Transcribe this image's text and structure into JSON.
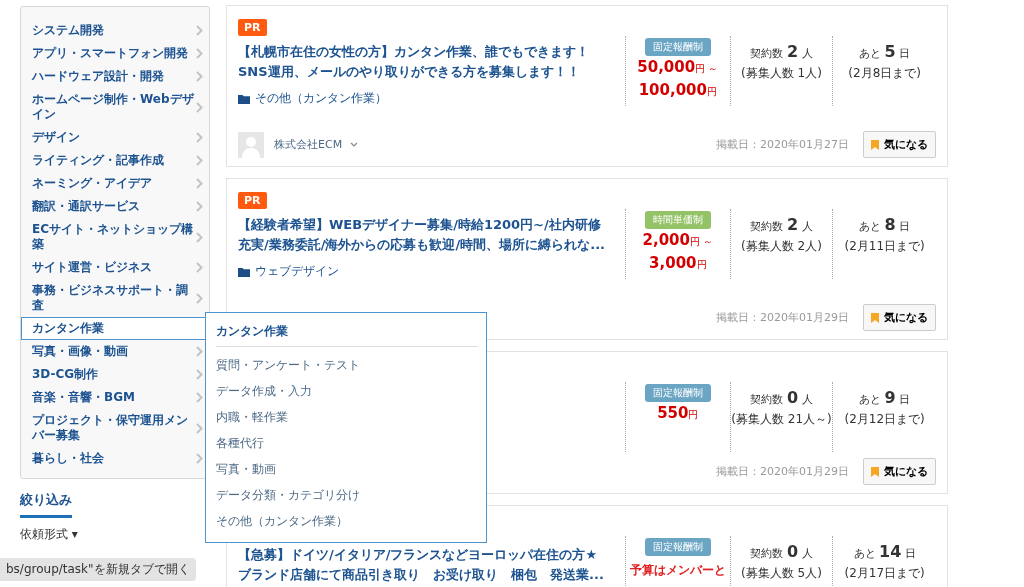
{
  "sidebar": {
    "items": [
      {
        "label": "システム開発",
        "selected": false
      },
      {
        "label": "アプリ・スマートフォン開発",
        "selected": false
      },
      {
        "label": "ハードウェア設計・開発",
        "selected": false
      },
      {
        "label": "ホームページ制作・Webデザイン",
        "selected": false
      },
      {
        "label": "デザイン",
        "selected": false
      },
      {
        "label": "ライティング・記事作成",
        "selected": false
      },
      {
        "label": "ネーミング・アイデア",
        "selected": false
      },
      {
        "label": "翻訳・通訳サービス",
        "selected": false
      },
      {
        "label": "ECサイト・ネットショップ構築",
        "selected": false
      },
      {
        "label": "サイト運営・ビジネス",
        "selected": false
      },
      {
        "label": "事務・ビジネスサポート・調査",
        "selected": false
      },
      {
        "label": "カンタン作業",
        "selected": true
      },
      {
        "label": "写真・画像・動画",
        "selected": false
      },
      {
        "label": "3D-CG制作",
        "selected": false
      },
      {
        "label": "音楽・音響・BGM",
        "selected": false
      },
      {
        "label": "プロジェクト・保守運用メンバー募集",
        "selected": false
      },
      {
        "label": "暮らし・社会",
        "selected": false
      }
    ]
  },
  "filter": {
    "heading": "絞り込み",
    "label": "依頼形式 ▾"
  },
  "submenu": {
    "title": "カンタン作業",
    "items": [
      "質問・アンケート・テスト",
      "データ作成・入力",
      "内職・軽作業",
      "各種代行",
      "写真・動画",
      "データ分類・カテゴリ分け",
      "その他（カンタン作業）"
    ]
  },
  "jobs": [
    {
      "pr": "PR",
      "title": "【札幌市在住の女性の方】カンタン作業、誰でもできます！SNS運用、メールのやり取りができる方を募集します！！",
      "category": "その他（カンタン作業）",
      "badge": {
        "label": "固定報酬制",
        "kind": "fixed"
      },
      "price": [
        {
          "amount": "50,000",
          "unit": "円 ～"
        },
        {
          "amount": "100,000",
          "unit": "円"
        }
      ],
      "contracts": {
        "label": "契約数",
        "count": "2",
        "unit": "人",
        "note": "(募集人数 1人)"
      },
      "deadline": {
        "prefix": "あと",
        "days": "5",
        "unit": "日",
        "note": "(2月8日まで)"
      },
      "company": "株式会社ECM",
      "posted": "掲載日：2020年01月27日",
      "bookmark": "気になる"
    },
    {
      "pr": "PR",
      "title": "【経験者希望】WEBデザイナー募集/時給1200円~/社内研修充実/業務委託/海外からの応募も歓迎/時間、場所に縛られな...",
      "category": "ウェブデザイン",
      "badge": {
        "label": "時間単価制",
        "kind": "hourly"
      },
      "price": [
        {
          "amount": "2,000",
          "unit": "円 ～"
        },
        {
          "amount": "3,000",
          "unit": "円"
        }
      ],
      "contracts": {
        "label": "契約数",
        "count": "2",
        "unit": "人",
        "note": "(募集人数 2人)"
      },
      "deadline": {
        "prefix": "あと",
        "days": "8",
        "unit": "日",
        "note": "(2月11日まで)"
      },
      "posted": "掲載日：2020年01月29日",
      "bookmark": "気になる"
    },
    {
      "badge": {
        "label": "固定報酬制",
        "kind": "fixed"
      },
      "price": [
        {
          "amount": "550",
          "unit": "円"
        }
      ],
      "contracts": {
        "label": "契約数",
        "count": "0",
        "unit": "人",
        "note": "(募集人数 21人～)"
      },
      "deadline": {
        "prefix": "あと",
        "days": "9",
        "unit": "日",
        "note": "(2月12日まで)"
      },
      "posted": "掲載日：2020年01月29日",
      "bookmark": "気になる"
    },
    {
      "title": "【急募】ドイツ/イタリア/フランスなどヨーロッパ在住の方★ブランド店舗にて商品引き取り　お受け取り　梱包　発送業...",
      "badge": {
        "label": "固定報酬制",
        "kind": "fixed"
      },
      "price_note": "予算はメンバーと",
      "contracts": {
        "label": "契約数",
        "count": "0",
        "unit": "人",
        "note": "(募集人数 5人)"
      },
      "deadline": {
        "prefix": "あと",
        "days": "14",
        "unit": "日",
        "note": "(2月17日まで)"
      }
    }
  ],
  "status_bar": "bs/group/task\"を新規タブで開く"
}
